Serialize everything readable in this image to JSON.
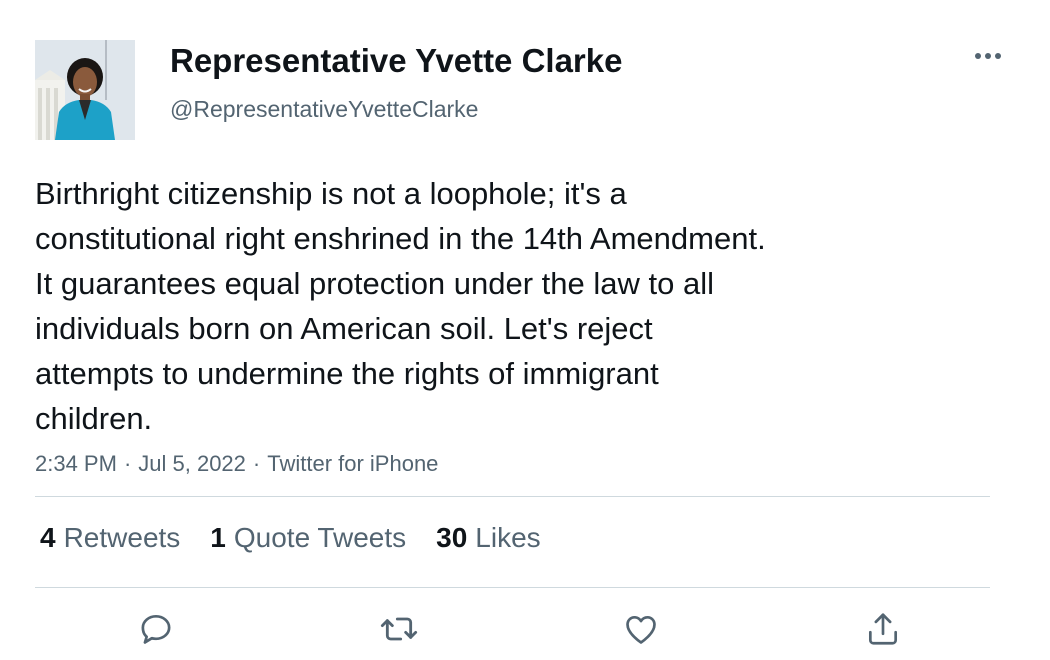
{
  "user": {
    "display_name": "Representative Yvette Clarke",
    "handle": "@RepresentativeYvetteClarke"
  },
  "tweet": {
    "text": "Birthright citizenship is not a loophole; it's a\nconstitutional right enshrined in the 14th Amendment.\nIt guarantees equal protection under the law to all\nindividuals born on American soil. Let's reject\nattempts to undermine the rights of immigrant\nchildren.",
    "time": "2:34 PM",
    "date": "Jul 5, 2022",
    "source": "Twitter for iPhone",
    "separator": "·"
  },
  "stats": {
    "retweets": {
      "count": "4",
      "label": "Retweets"
    },
    "quote_tweets": {
      "count": "1",
      "label": "Quote Tweets"
    },
    "likes": {
      "count": "30",
      "label": "Likes"
    }
  },
  "actions": [
    {
      "icon": "reply-icon"
    },
    {
      "icon": "retweet-icon"
    },
    {
      "icon": "like-heart-icon"
    },
    {
      "icon": "share-icon"
    }
  ],
  "colors": {
    "text_primary": "#0f1419",
    "text_secondary": "#536471",
    "divider": "#cfd9de",
    "avatar_jacket": "#1da1c8"
  }
}
